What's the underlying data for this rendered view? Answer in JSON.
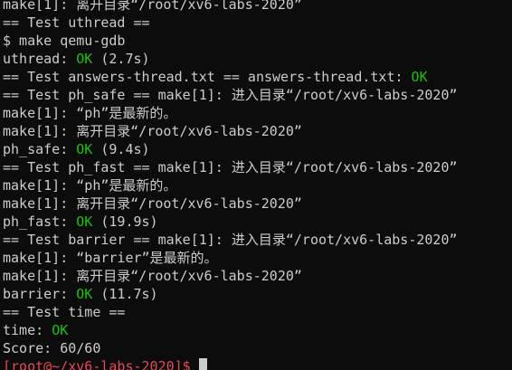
{
  "terminal": {
    "lines": [
      {
        "text": "make[1]: 离开目录“/root/xv6-labs-2020”"
      },
      {
        "text": "== Test uthread =="
      },
      {
        "text": "$ make qemu-gdb"
      },
      {
        "text": "uthread: ",
        "ok": "OK",
        "after": " (2.7s)"
      },
      {
        "text": "== Test answers-thread.txt == answers-thread.txt: ",
        "ok": "OK",
        "after": ""
      },
      {
        "text": "== Test ph_safe == make[1]: 进入目录“/root/xv6-labs-2020”"
      },
      {
        "text": "make[1]: “ph”是最新的。"
      },
      {
        "text": "make[1]: 离开目录“/root/xv6-labs-2020”"
      },
      {
        "text": "ph_safe: ",
        "ok": "OK",
        "after": " (9.4s)"
      },
      {
        "text": "== Test ph_fast == make[1]: 进入目录“/root/xv6-labs-2020”"
      },
      {
        "text": "make[1]: “ph”是最新的。"
      },
      {
        "text": "make[1]: 离开目录“/root/xv6-labs-2020”"
      },
      {
        "text": "ph_fast: ",
        "ok": "OK",
        "after": " (19.9s)"
      },
      {
        "text": "== Test barrier == make[1]: 进入目录“/root/xv6-labs-2020”"
      },
      {
        "text": "make[1]: “barrier”是最新的。"
      },
      {
        "text": "make[1]: 离开目录“/root/xv6-labs-2020”"
      },
      {
        "text": "barrier: ",
        "ok": "OK",
        "after": " (11.7s)"
      },
      {
        "text": "== Test time =="
      },
      {
        "text": "time: ",
        "ok": "OK",
        "after": ""
      },
      {
        "text": "Score: 60/60"
      }
    ],
    "prompt": "[root@~/xv6-labs-2020]$ ",
    "colors": {
      "background": "#0c0c0c",
      "foreground": "#cccccc",
      "ok": "#16c60c",
      "prompt": "#e74856"
    }
  }
}
